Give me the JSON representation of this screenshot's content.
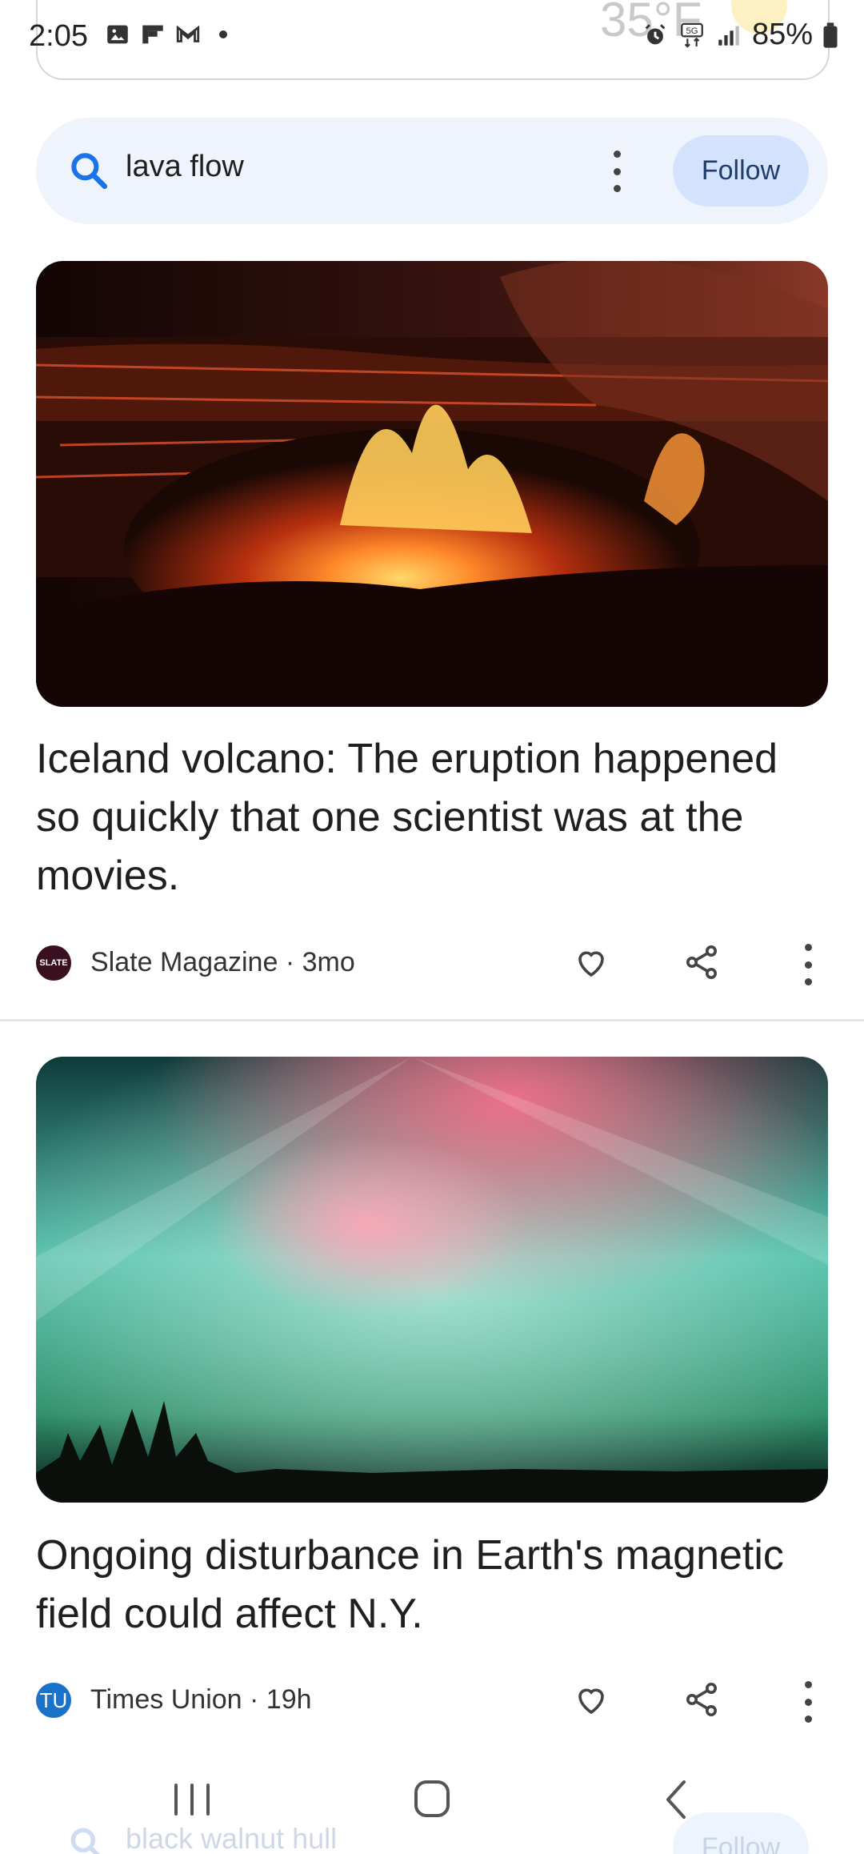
{
  "status_bar": {
    "time": "2:05",
    "battery": "85%",
    "network": "5G"
  },
  "search_header": {
    "query": "lava flow",
    "follow_label": "Follow"
  },
  "articles": [
    {
      "title": "Iceland volcano: The eruption happened so quickly that one scientist was at the movies.",
      "source": "Slate Magazine",
      "age": "3mo",
      "source_logo_text": "SLATE",
      "source_logo_color": "#3a1020",
      "image_icon": "volcano-eruption-image"
    },
    {
      "title": "Ongoing disturbance in Earth's magnetic field could affect N.Y.",
      "source": "Times Union",
      "age": "19h",
      "source_logo_text": "TU",
      "source_logo_color": "#1a73c9",
      "image_icon": "aurora-borealis-image"
    }
  ],
  "next_search": {
    "query": "black walnut hull",
    "follow_label": "Follow"
  },
  "colors": {
    "search_pill_bg": "#eff3fb",
    "follow_bg": "#d3e3fd",
    "accent_blue": "#1a73e8"
  }
}
